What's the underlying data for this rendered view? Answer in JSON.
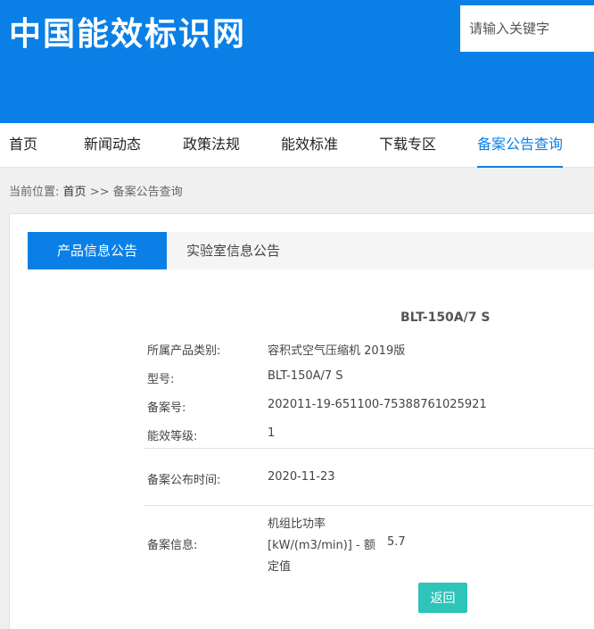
{
  "header": {
    "logo_text": "中国能效标识网",
    "search_placeholder": "请输入关键字"
  },
  "nav": {
    "items": [
      {
        "label": "首页"
      },
      {
        "label": "新闻动态"
      },
      {
        "label": "政策法规"
      },
      {
        "label": "能效标准"
      },
      {
        "label": "下载专区"
      },
      {
        "label": "备案公告查询",
        "active": true
      }
    ]
  },
  "breadcrumb": {
    "prefix": "当前位置:",
    "home": "首页",
    "separator": ">>",
    "current": "备案公告查询"
  },
  "tabs": {
    "active": "产品信息公告",
    "inactive": "实验室信息公告"
  },
  "product": {
    "title": "BLT-150A/7 S",
    "rows": [
      {
        "label": "所属产品类别:",
        "value": "容积式空气压缩机 2019版"
      },
      {
        "label": "型号:",
        "value": "BLT-150A/7 S"
      },
      {
        "label": "备案号:",
        "value": "202011-19-651100-75388761025921"
      },
      {
        "label": "能效等级:",
        "value": "1"
      },
      {
        "label": "备案公布时间:",
        "value": "2020-11-23"
      }
    ],
    "info": {
      "label": "备案信息:",
      "param_line1": "机组比功率",
      "param_line2": "[kW/(m3/min)] - 额",
      "param_line3": "定值",
      "param_value": "5.7"
    }
  },
  "actions": {
    "back_label": "返回"
  },
  "colors": {
    "brand_blue": "#0a80e6",
    "back_button": "#2ec4b9"
  }
}
